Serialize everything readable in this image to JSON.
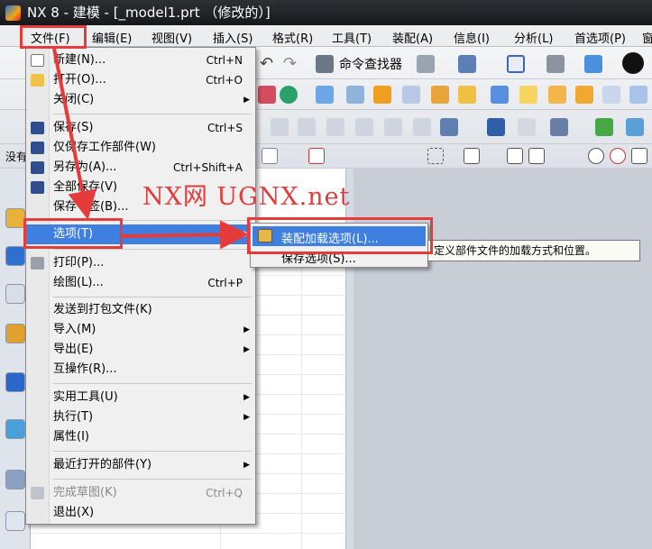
{
  "window": {
    "title": "NX 8 - 建模 - [_model1.prt （修改的）]"
  },
  "menubar": {
    "items": [
      "文件(F)",
      "编辑(E)",
      "视图(V)",
      "插入(S)",
      "格式(R)",
      "工具(T)",
      "装配(A)",
      "信息(I)",
      "分析(L)",
      "首选项(P)",
      "窗"
    ]
  },
  "toolbar": {
    "command_finder_label": "命令查找器",
    "row4_label": "没有"
  },
  "file_menu": {
    "items": [
      {
        "label": "新建(N)...",
        "shortcut": "Ctrl+N"
      },
      {
        "label": "打开(O)...",
        "shortcut": "Ctrl+O"
      },
      {
        "label": "关闭(C)",
        "submenu": true
      },
      {
        "label": "保存(S)",
        "shortcut": "Ctrl+S"
      },
      {
        "label": "仅保存工作部件(W)"
      },
      {
        "label": "另存为(A)...",
        "shortcut": "Ctrl+Shift+A"
      },
      {
        "label": "全部保存(V)"
      },
      {
        "label": "保存书签(B)..."
      },
      {
        "label": "选项(T)",
        "submenu": true,
        "highlighted": true
      },
      {
        "label": "打印(P)..."
      },
      {
        "label": "绘图(L)...",
        "shortcut": "Ctrl+P"
      },
      {
        "label": "发送到打包文件(K)"
      },
      {
        "label": "导入(M)",
        "submenu": true
      },
      {
        "label": "导出(E)",
        "submenu": true
      },
      {
        "label": "互操作(R)..."
      },
      {
        "label": "实用工具(U)",
        "submenu": true
      },
      {
        "label": "执行(T)",
        "submenu": true
      },
      {
        "label": "属性(I)"
      },
      {
        "label": "最近打开的部件(Y)",
        "submenu": true
      },
      {
        "label": "完成草图(K)",
        "shortcut": "Ctrl+Q",
        "disabled": true
      },
      {
        "label": "退出(X)"
      }
    ]
  },
  "options_submenu": {
    "items": [
      "装配加载选项(L)...",
      "保存选项(S)..."
    ]
  },
  "tooltip": {
    "text": "定义部件文件的加载方式和位置。"
  },
  "watermark": {
    "text": "NX网 UGNX.net"
  },
  "colors": {
    "highlight": "#3f7fe0",
    "annotation_red": "#e63b3b",
    "titlebar": "#1f2024"
  }
}
